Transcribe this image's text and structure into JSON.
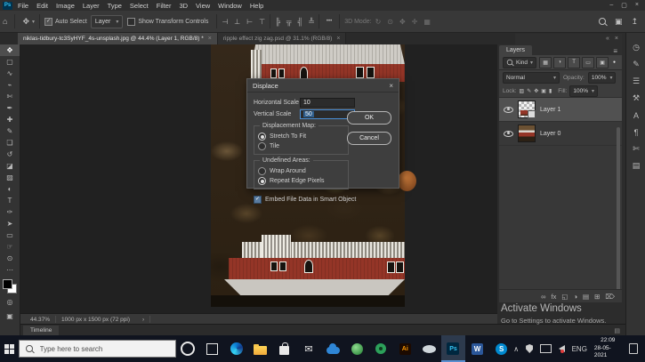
{
  "colors": {
    "ps_brand_blue": "#35c3f3",
    "focus_blue": "#4a90d9",
    "selection_blue": "#2e5d8c",
    "house_red": "#943527",
    "taskbar_dark": "#10141f",
    "panel_gray": "#383838"
  },
  "icons": {
    "ps_logo": "Ps",
    "home": "⌂",
    "move": "✥",
    "dropdown": "▾",
    "check": "✓",
    "ellipsis": "•••",
    "workspace": "▣",
    "share": "↥",
    "minimize": "–",
    "restore": "▢",
    "close": "×",
    "panel_menu": "≡",
    "collapse": "«",
    "arrow": "›",
    "chevron_up": "∧",
    "mail": "✉",
    "dot": "●",
    "timeline_menu": "▤"
  },
  "menu_bar": {
    "items": [
      {
        "name": "menu-file",
        "label": "File"
      },
      {
        "name": "menu-edit",
        "label": "Edit"
      },
      {
        "name": "menu-image",
        "label": "Image"
      },
      {
        "name": "menu-layer",
        "label": "Layer"
      },
      {
        "name": "menu-type",
        "label": "Type"
      },
      {
        "name": "menu-select",
        "label": "Select"
      },
      {
        "name": "menu-filter",
        "label": "Filter"
      },
      {
        "name": "menu-3d",
        "label": "3D"
      },
      {
        "name": "menu-view",
        "label": "View"
      },
      {
        "name": "menu-window",
        "label": "Window"
      },
      {
        "name": "menu-help",
        "label": "Help"
      }
    ]
  },
  "options_bar": {
    "auto_select_label": "Auto Select",
    "layer_value": "Layer",
    "show_transform_label": "Show Transform Controls",
    "mode_3d_label": "3D Mode:",
    "align_icons": [
      {
        "name": "align-left-icon",
        "glyph": "⊣"
      },
      {
        "name": "align-center-icon",
        "glyph": "⊥"
      },
      {
        "name": "align-right-icon",
        "glyph": "⊢"
      },
      {
        "name": "align-top-icon",
        "glyph": "⊤"
      }
    ],
    "distribute_icons": [
      {
        "name": "distribute-left-icon",
        "glyph": "╠"
      },
      {
        "name": "distribute-top-icon",
        "glyph": "╦"
      },
      {
        "name": "distribute-right-icon",
        "glyph": "╣"
      },
      {
        "name": "distribute-bottom-icon",
        "glyph": "╩"
      }
    ],
    "mode_3d_icons": [
      {
        "name": "3d-rotate-icon",
        "glyph": "↻"
      },
      {
        "name": "3d-roll-icon",
        "glyph": "⊙"
      },
      {
        "name": "3d-drag-icon",
        "glyph": "✥"
      },
      {
        "name": "3d-slide-icon",
        "glyph": "✛"
      },
      {
        "name": "3d-scale-icon",
        "glyph": "▦"
      }
    ]
  },
  "tabs": [
    {
      "name": "document-tab-unsplash",
      "title": "niklas-tidbury-tc3SyHYF_4s-unsplash.jpg @ 44.4% (Layer 1, RGB/8) *",
      "close": "×",
      "active": true
    },
    {
      "name": "document-tab-ripple",
      "title": "ripple effect zig zag.psd @ 31.1% (RGB/8)",
      "close": "×",
      "active": false
    }
  ],
  "toolbar": {
    "tools": [
      {
        "name": "move-tool",
        "glyph": "✥",
        "active": true
      },
      {
        "name": "marquee-tool",
        "glyph": "▢"
      },
      {
        "name": "lasso-tool",
        "glyph": "∿"
      },
      {
        "name": "quick-selection-tool",
        "glyph": "⌁"
      },
      {
        "name": "crop-tool",
        "glyph": "✄"
      },
      {
        "name": "eyedropper-tool",
        "glyph": "✒"
      },
      {
        "name": "spot-healing-tool",
        "glyph": "✚"
      },
      {
        "name": "brush-tool",
        "glyph": "✎"
      },
      {
        "name": "clone-stamp-tool",
        "glyph": "❏"
      },
      {
        "name": "history-brush-tool",
        "glyph": "↺"
      },
      {
        "name": "eraser-tool",
        "glyph": "◪"
      },
      {
        "name": "gradient-tool",
        "glyph": "▨"
      },
      {
        "name": "blur-tool",
        "glyph": "◐"
      },
      {
        "name": "type-tool",
        "glyph": "T"
      },
      {
        "name": "pen-tool",
        "glyph": "✑"
      },
      {
        "name": "path-selection-tool",
        "glyph": "➤"
      },
      {
        "name": "rectangle-tool",
        "glyph": "▭"
      },
      {
        "name": "hand-tool",
        "glyph": "☞"
      },
      {
        "name": "zoom-tool",
        "glyph": "⊙"
      },
      {
        "name": "edit-toolbar",
        "glyph": "⋯"
      }
    ],
    "quick_mask_glyph": "◎",
    "screen_mode_glyph": "▣"
  },
  "right_strip": {
    "panels": [
      {
        "name": "history-panel-icon",
        "glyph": "◷"
      },
      {
        "name": "brush-settings-icon",
        "glyph": "✎"
      },
      {
        "name": "brushes-panel-icon",
        "glyph": "☰"
      },
      {
        "name": "clone-source-icon",
        "glyph": "⚒"
      },
      {
        "name": "character-panel-icon",
        "glyph": "A"
      },
      {
        "name": "paragraph-panel-icon",
        "glyph": "¶"
      },
      {
        "name": "libraries-panel-icon",
        "glyph": "✄"
      },
      {
        "name": "properties-panel-icon",
        "glyph": "▤"
      }
    ]
  },
  "layers_panel": {
    "tab_label": "Layers",
    "kind_label": "Kind",
    "filter_icons": [
      {
        "name": "filter-pixel-icon",
        "glyph": "▦"
      },
      {
        "name": "filter-adjustment-icon",
        "glyph": "◑"
      },
      {
        "name": "filter-type-icon",
        "glyph": "T"
      },
      {
        "name": "filter-shape-icon",
        "glyph": "▭"
      },
      {
        "name": "filter-smart-icon",
        "glyph": "▣"
      }
    ],
    "blend_mode": "Normal",
    "opacity_label": "Opacity:",
    "opacity_value": "100%",
    "lock_label": "Lock:",
    "lock_icons": [
      {
        "name": "lock-transparency-icon",
        "glyph": "▨"
      },
      {
        "name": "lock-pixels-icon",
        "glyph": "✎"
      },
      {
        "name": "lock-position-icon",
        "glyph": "✥"
      },
      {
        "name": "lock-artboard-icon",
        "glyph": "▣"
      },
      {
        "name": "lock-all-icon",
        "glyph": "▮"
      }
    ],
    "fill_label": "Fill:",
    "fill_value": "100%",
    "layers": [
      {
        "name": "layer-row-1",
        "label": "Layer 1",
        "selected": true,
        "thumb": "checker"
      },
      {
        "name": "layer-row-0",
        "label": "Layer 0",
        "thumb": "image"
      }
    ],
    "bottom_icons": [
      {
        "name": "link-layers-icon",
        "glyph": "∞"
      },
      {
        "name": "layer-effects-icon",
        "glyph": "fx"
      },
      {
        "name": "add-layer-mask-icon",
        "glyph": "◱"
      },
      {
        "name": "new-adjustment-layer-icon",
        "glyph": "◑"
      },
      {
        "name": "new-group-icon",
        "glyph": "▤"
      },
      {
        "name": "new-layer-icon",
        "glyph": "⊞"
      },
      {
        "name": "delete-layer-icon",
        "glyph": "⌦"
      }
    ]
  },
  "dialog": {
    "title": "Displace",
    "horizontal_scale_label": "Horizontal Scale",
    "horizontal_scale_value": "10",
    "vertical_scale_label": "Vertical Scale",
    "vertical_scale_value": "50",
    "displacement_map_label": "Displacement Map:",
    "stretch_to_fit_label": "Stretch To Fit",
    "tile_label": "Tile",
    "undefined_areas_label": "Undefined Areas:",
    "wrap_around_label": "Wrap Around",
    "repeat_edge_label": "Repeat Edge Pixels",
    "embed_label": "Embed File Data in Smart Object",
    "ok_label": "OK",
    "cancel_label": "Cancel"
  },
  "status_bar": {
    "zoom_level": "44.37%",
    "doc_info": "1000 px x 1500 px (72 ppi)"
  },
  "timeline": {
    "label": "Timeline"
  },
  "watermark": {
    "line1": "Activate Windows",
    "line2": "Go to Settings to activate Windows."
  },
  "taskbar": {
    "search_placeholder": "Type here to search",
    "app_letters": {
      "illustrator": "Ai",
      "photoshop": "Ps",
      "word": "W",
      "skype": "S"
    },
    "tray": {
      "lang": "ENG",
      "time": "22:09",
      "date": "28-05-2021"
    }
  }
}
